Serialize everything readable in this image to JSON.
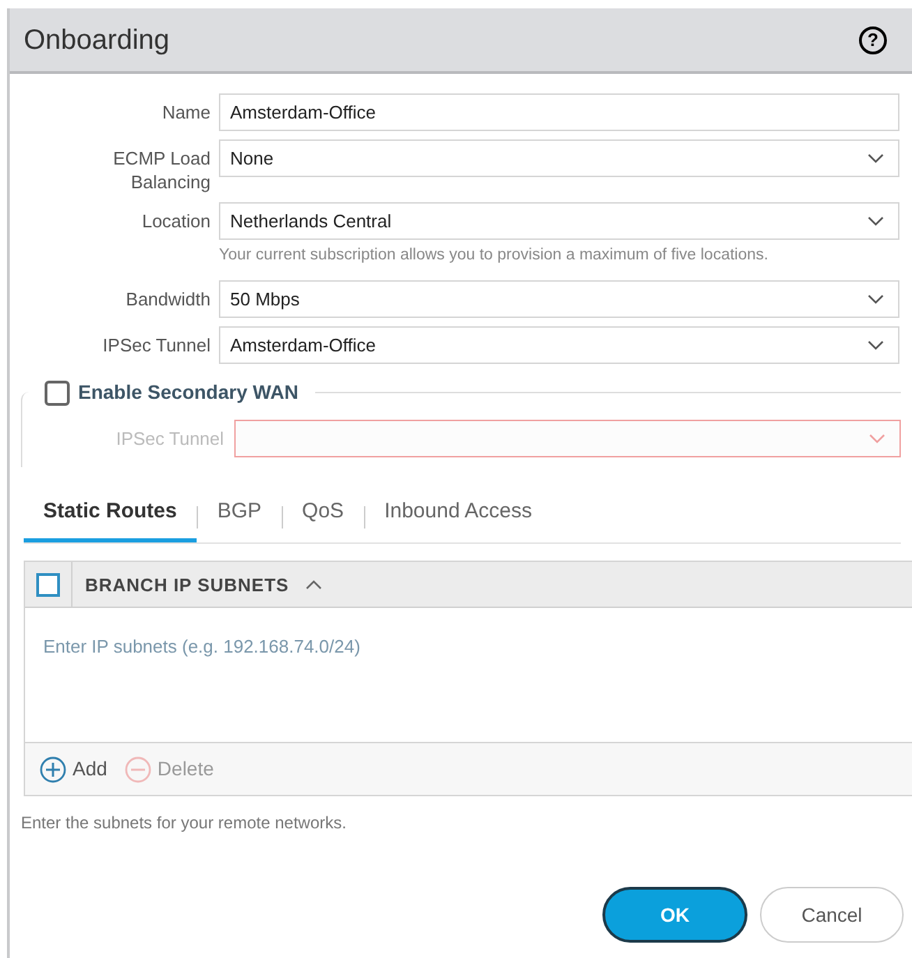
{
  "dialog": {
    "title": "Onboarding",
    "help": "?"
  },
  "fields": [
    {
      "label": "Name",
      "value": "Amsterdam-Office",
      "kind": "text"
    },
    {
      "label": "ECMP Load Balancing",
      "value": "None",
      "kind": "select"
    },
    {
      "label": "Location",
      "value": "Netherlands Central",
      "kind": "select",
      "hint": "Your current subscription allows you to provision a maximum of five locations."
    },
    {
      "label": "Bandwidth",
      "value": "50 Mbps",
      "kind": "select"
    },
    {
      "label": "IPSec Tunnel",
      "value": "Amsterdam-Office",
      "kind": "select"
    }
  ],
  "secondary_wan": {
    "label": "Enable Secondary WAN",
    "checked": false,
    "field": {
      "label": "IPSec Tunnel",
      "disabled": true,
      "invalid": true
    }
  },
  "tabs": [
    {
      "label": "Static Routes",
      "selected": true
    },
    {
      "label": "BGP",
      "selected": false
    },
    {
      "label": "QoS",
      "selected": false
    },
    {
      "label": "Inbound Access",
      "selected": false
    }
  ],
  "table": {
    "select_all": {
      "checked": false
    },
    "column": "BRANCH IP SUBNETS",
    "placeholder": "Enter IP subnets (e.g. 192.168.74.0/24)",
    "actions": [
      {
        "label": "Add",
        "kind": "add",
        "disabled": false
      },
      {
        "label": "Delete",
        "kind": "delete",
        "disabled": true
      }
    ]
  },
  "help_text": "Enter the subnets for your remote networks.",
  "buttons": [
    {
      "label": "OK",
      "kind": "primary"
    },
    {
      "label": "Cancel",
      "kind": "secondary"
    }
  ]
}
